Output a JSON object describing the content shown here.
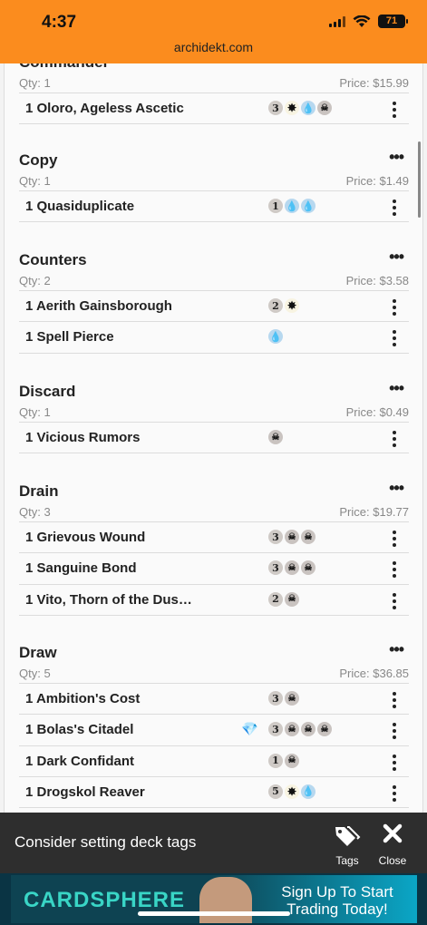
{
  "status": {
    "time": "4:37",
    "battery": "71",
    "url": "archidekt.com"
  },
  "sections": [
    {
      "title": "Commander",
      "qty": "Qty: 1",
      "price": "Price: $15.99",
      "cards": [
        {
          "name": "1 Oloro, Ageless Ascetic",
          "mana": [
            "3",
            "W",
            "U",
            "B"
          ]
        }
      ]
    },
    {
      "title": "Copy",
      "more": "•••",
      "qty": "Qty: 1",
      "price": "Price: $1.49",
      "cards": [
        {
          "name": "1 Quasiduplicate",
          "mana": [
            "1",
            "U",
            "U"
          ]
        }
      ]
    },
    {
      "title": "Counters",
      "more": "•••",
      "qty": "Qty: 2",
      "price": "Price: $3.58",
      "cards": [
        {
          "name": "1 Aerith Gainsborough",
          "mana": [
            "2",
            "W"
          ]
        },
        {
          "name": "1 Spell Pierce",
          "mana": [
            "U"
          ]
        }
      ]
    },
    {
      "title": "Discard",
      "more": "•••",
      "qty": "Qty: 1",
      "price": "Price: $0.49",
      "cards": [
        {
          "name": "1 Vicious Rumors",
          "mana": [
            "B"
          ]
        }
      ]
    },
    {
      "title": "Drain",
      "more": "•••",
      "qty": "Qty: 3",
      "price": "Price: $19.77",
      "cards": [
        {
          "name": "1 Grievous Wound",
          "mana": [
            "3",
            "B",
            "B"
          ]
        },
        {
          "name": "1 Sanguine Bond",
          "mana": [
            "3",
            "B",
            "B"
          ]
        },
        {
          "name": "1 Vito, Thorn of the Dus…",
          "mana": [
            "2",
            "B"
          ]
        }
      ]
    },
    {
      "title": "Draw",
      "more": "•••",
      "qty": "Qty: 5",
      "price": "Price: $36.85",
      "cards": [
        {
          "name": "1 Ambition's Cost",
          "mana": [
            "3",
            "B"
          ]
        },
        {
          "name": "1 Bolas's Citadel",
          "mana": [
            "3",
            "B",
            "B",
            "B"
          ],
          "type_icon": "gem-icon"
        },
        {
          "name": "1 Dark Confidant",
          "mana": [
            "1",
            "B"
          ]
        },
        {
          "name": "1 Drogskol Reaver",
          "mana": [
            "5",
            "W",
            "U"
          ]
        }
      ]
    }
  ],
  "toast": {
    "message": "Consider setting deck tags",
    "tags_label": "Tags",
    "close_label": "Close"
  },
  "ad": {
    "brand": "CARDSPHERE",
    "cta": "Sign Up To Start Trading Today!"
  }
}
